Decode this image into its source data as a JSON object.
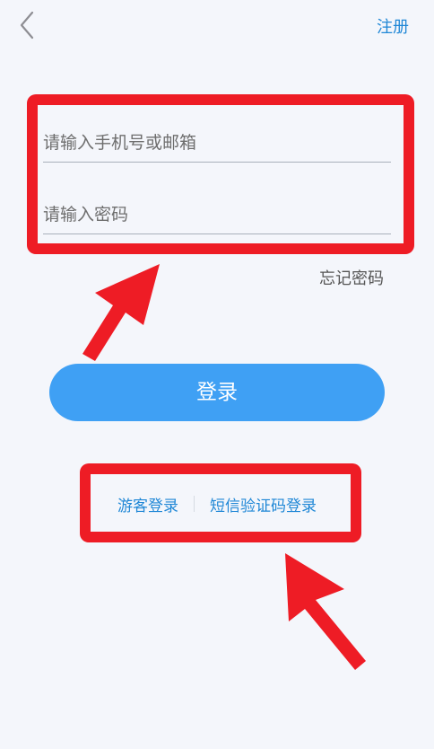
{
  "header": {
    "back_icon": "chevron-left-icon",
    "register_label": "注册"
  },
  "form": {
    "account_placeholder": "请输入手机号或邮箱",
    "account_value": "",
    "password_placeholder": "请输入密码",
    "password_value": "",
    "forgot_label": "忘记密码",
    "login_label": "登录"
  },
  "alt_logins": {
    "guest_label": "游客登录",
    "sms_label": "短信验证码登录"
  },
  "colors": {
    "background": "#f4f6fb",
    "accent_blue": "#3fa0f4",
    "link_blue": "#1f87d6",
    "annotation_red": "#ee1c25"
  }
}
